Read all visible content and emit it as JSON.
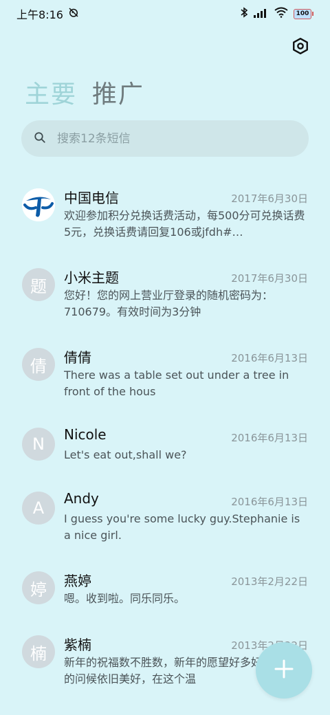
{
  "status": {
    "time": "上午8:16",
    "battery": "100"
  },
  "tabs": [
    {
      "label": "主要",
      "active": true
    },
    {
      "label": "推广",
      "active": false
    }
  ],
  "search": {
    "placeholder": "搜索12条短信"
  },
  "messages": [
    {
      "avatar": "",
      "avatar_type": "logo",
      "name": "中国电信",
      "date": "2017年6月30日",
      "preview": "欢迎参加积分兑换话费活动，每500分可兑换话费5元，兑换话费请回复106或jfdh#…"
    },
    {
      "avatar": "题",
      "avatar_type": "initial",
      "name": "小米主题",
      "date": "2017年6月30日",
      "preview": "您好！您的网上营业厅登录的随机密码为：710679。有效时间为3分钟"
    },
    {
      "avatar": "倩",
      "avatar_type": "initial",
      "name": "倩倩",
      "date": "2016年6月13日",
      "preview": "There was a table set out under a tree in front of the hous"
    },
    {
      "avatar": "N",
      "avatar_type": "initial",
      "name": "Nicole",
      "date": "2016年6月13日",
      "preview": "Let's eat out,shall we?"
    },
    {
      "avatar": "A",
      "avatar_type": "initial",
      "name": "Andy",
      "date": "2016年6月13日",
      "preview": "I guess you're some lucky guy.Stephanie is a nice girl."
    },
    {
      "avatar": "婷",
      "avatar_type": "initial",
      "name": "燕婷",
      "date": "2013年2月22日",
      "preview": "嗯。收到啦。同乐同乐。"
    },
    {
      "avatar": "楠",
      "avatar_type": "initial",
      "name": "紫楠",
      "date": "2013年2月22日",
      "preview": "新年的祝福数不胜数，新年的愿望好多好多，新年的问候依旧美好，在这个温"
    }
  ],
  "colors": {
    "background": "#d9f4f8",
    "accent": "#a9dfe6",
    "tab_active": "#9fd4d8"
  }
}
